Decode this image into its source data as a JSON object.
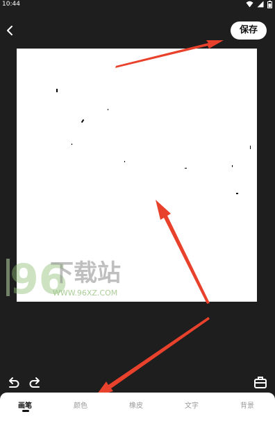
{
  "status_bar": {
    "time": "10:44"
  },
  "header": {
    "save_label": "保存"
  },
  "watermark": {
    "number": "96",
    "name": "下载站",
    "url": "WWW.96XZ.COM"
  },
  "tabs": [
    {
      "label": "画笔",
      "active": true
    },
    {
      "label": "颜色",
      "active": false
    },
    {
      "label": "橡皮",
      "active": false
    },
    {
      "label": "文字",
      "active": false
    },
    {
      "label": "背景",
      "active": false
    }
  ],
  "colors": {
    "background": "#1e1e1e",
    "canvas": "#ffffff",
    "annotation_arrow": "#e8412c"
  }
}
